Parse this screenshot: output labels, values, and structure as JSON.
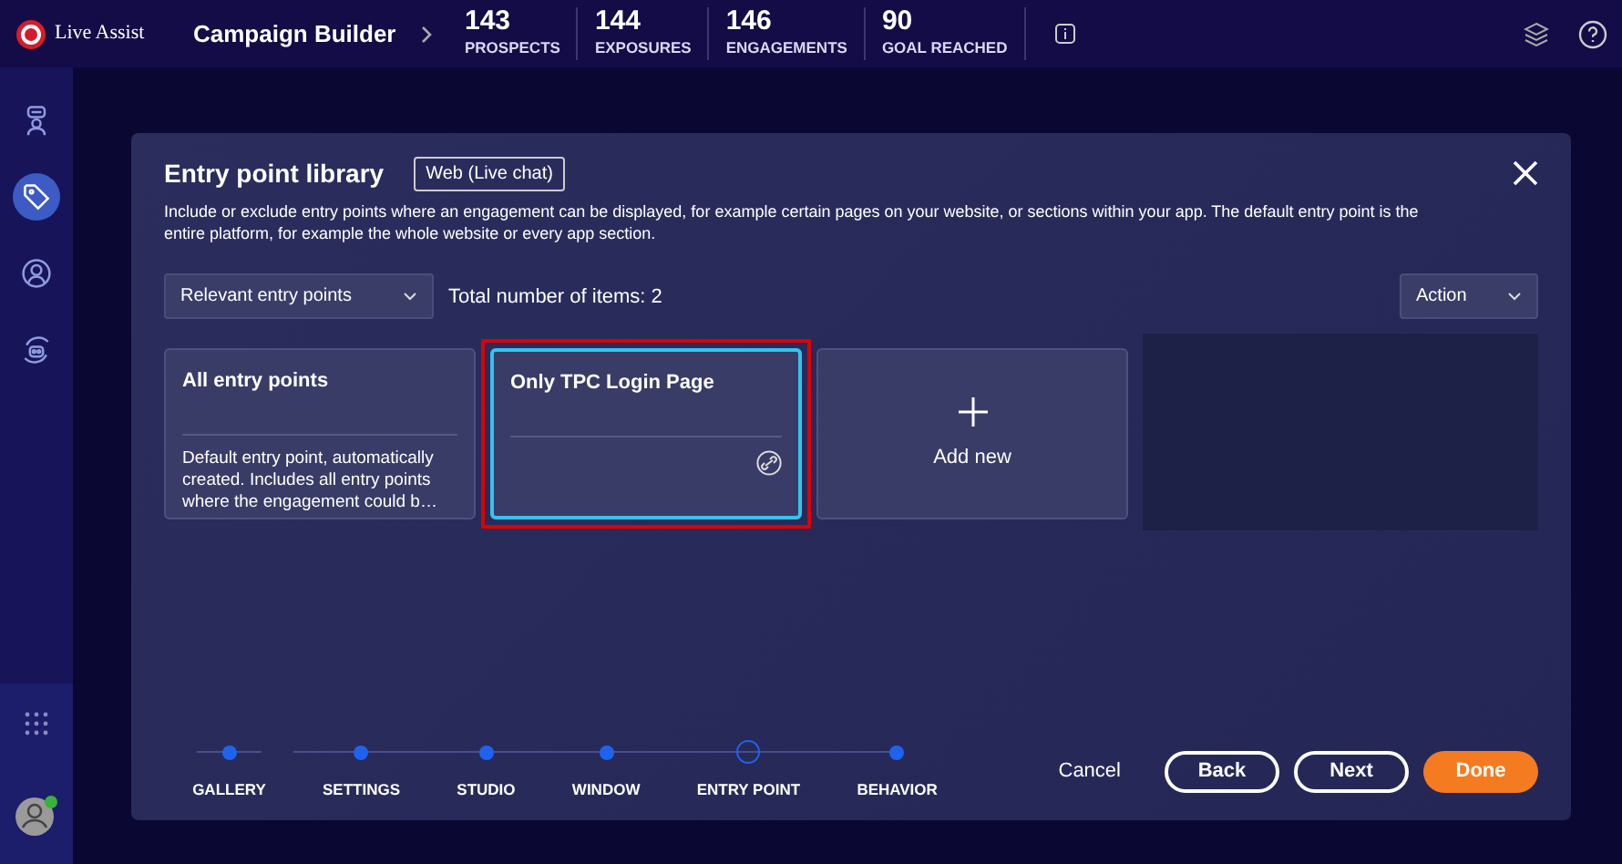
{
  "app": {
    "logo_text": "Live Assist",
    "title": "Campaign Builder"
  },
  "stats": [
    {
      "value": "143",
      "label": "PROSPECTS"
    },
    {
      "value": "144",
      "label": "EXPOSURES"
    },
    {
      "value": "146",
      "label": "ENGAGEMENTS"
    },
    {
      "value": "90",
      "label": "GOAL REACHED"
    }
  ],
  "sidebar": {
    "items": [
      {
        "selected": false
      },
      {
        "selected": true
      },
      {
        "selected": false
      },
      {
        "selected": false
      }
    ],
    "user_online": true
  },
  "dialog": {
    "title": "Entry point library",
    "channel_tag": "Web (Live chat)",
    "description": "Include or exclude entry points where an engagement can be displayed, for example certain pages on your website, or sections within your app. The default entry point is the entire platform, for example the whole website or every app section.",
    "filter": "Relevant entry points",
    "total": "Total number of items: 2",
    "action": "Action",
    "cards": [
      {
        "kind": "entry",
        "title": "All entry points",
        "description": "Default entry point, automatically created. Includes all entry points where the engagement could b…",
        "selected": false,
        "linked": false
      },
      {
        "kind": "entry",
        "title": "Only TPC Login Page",
        "selected": true,
        "linked": true,
        "highlighted": true
      },
      {
        "kind": "add",
        "title": "Add new"
      }
    ],
    "steps": [
      {
        "label": "GALLERY",
        "current": false
      },
      {
        "label": "SETTINGS",
        "current": false
      },
      {
        "label": "STUDIO",
        "current": false
      },
      {
        "label": "WINDOW",
        "current": false
      },
      {
        "label": "ENTRY POINT",
        "current": true
      },
      {
        "label": "BEHAVIOR",
        "current": false
      }
    ],
    "buttons": [
      {
        "kind": "link",
        "label": "Cancel"
      },
      {
        "kind": "outline",
        "label": "Back"
      },
      {
        "kind": "outline",
        "label": "Next"
      },
      {
        "kind": "primary",
        "label": "Done"
      }
    ]
  }
}
